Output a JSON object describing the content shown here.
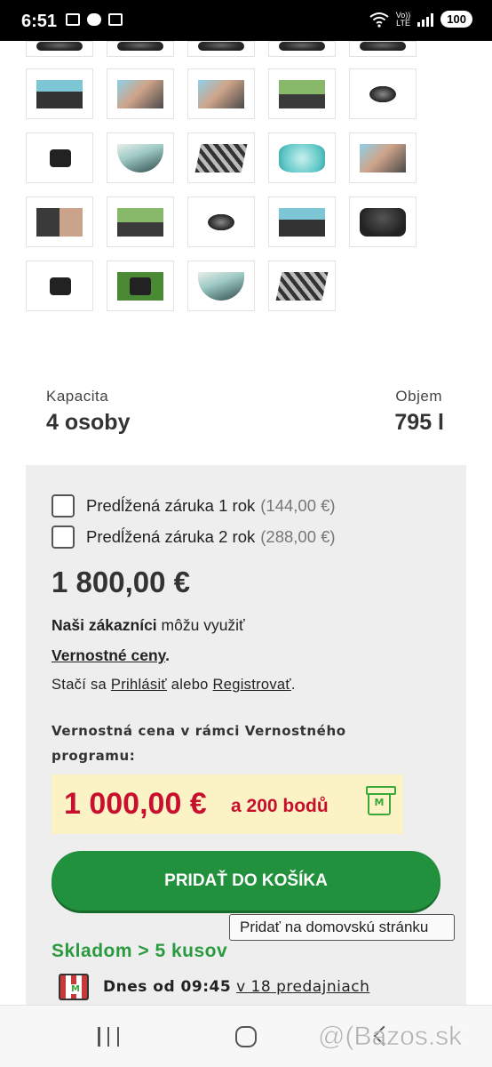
{
  "status_bar": {
    "time": "6:51",
    "network_top": "Vo))",
    "network_bottom": "LTE",
    "battery": "100",
    "icons": [
      "image-icon",
      "cloud-icon",
      "calendar-icon",
      "wifi-icon",
      "signal-icon",
      "battery-icon"
    ]
  },
  "specs": {
    "capacity_label": "Kapacita",
    "capacity_value": "4 osoby",
    "volume_label": "Objem",
    "volume_value": "795 l"
  },
  "warranty": {
    "option1_label": "Predĺžená záruka 1 rok",
    "option1_price": "(144,00 €)",
    "option1_checked": false,
    "option2_label": "Predĺžená záruka 2 rok",
    "option2_price": "(288,00 €)",
    "option2_checked": false
  },
  "pricing": {
    "price": "1 800,00 €",
    "customers_bold": "Naši zákazníci",
    "customers_rest": " môžu využiť",
    "loyalty_link": "Vernostné ceny",
    "loyalty_dot": ".",
    "login_prefix": "Stačí sa ",
    "login_link": "Prihlásiť",
    "login_middle": " alebo ",
    "register_link": "Registrovať",
    "login_suffix": ".",
    "loyalty_heading_1": "Vernostná cena v rámci Vernostného",
    "loyalty_heading_2": "programu:",
    "loyalty_price": "1 000,00 €",
    "loyalty_points": "a 200 bodů",
    "gift_letter": "M"
  },
  "cart": {
    "button_label": "PRIDAŤ DO KOŠÍKA",
    "tooltip": "Pridať na domovskú stránku"
  },
  "stock": {
    "status": "Skladom > 5 kusov",
    "store_bold": "Dnes od 09:45",
    "store_link": "v 18 predajniach"
  },
  "watermark": "@(Bazos.sk",
  "colors": {
    "accent_green": "#22913d",
    "stock_green": "#2a9a3f",
    "loyalty_red": "#c8102e",
    "loyalty_bg": "#fbf3c6",
    "panel_bg": "#eeeeee"
  }
}
